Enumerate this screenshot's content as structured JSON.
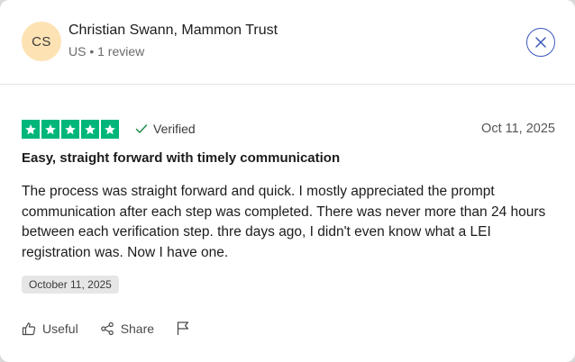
{
  "reviewer": {
    "initials": "CS",
    "name": "Christian Swann, Mammon Trust",
    "meta": "US • 1 review"
  },
  "review": {
    "rating": 5,
    "rating_max": 5,
    "verified_label": "Verified",
    "date": "Oct 11, 2025",
    "title": "Easy, straight forward with timely communication",
    "body": "The process was straight forward and quick. I mostly appreciated the prompt communication after each step was completed. There was never more than 24 hours between each verification step. thre days ago, I didn't even know what a LEI registration was. Now I have one.",
    "experience_date": "October 11, 2025"
  },
  "actions": {
    "useful_label": "Useful",
    "share_label": "Share"
  },
  "icons": {
    "close": "close-icon",
    "star": "star-icon",
    "verified": "check-icon",
    "useful": "thumbs-up-icon",
    "share": "share-icon",
    "report": "flag-icon"
  },
  "colors": {
    "star_green": "#00b67a",
    "close_blue": "#3c57bc",
    "avatar_bg": "#fde3b4",
    "verified_check": "#1c8f4a"
  }
}
